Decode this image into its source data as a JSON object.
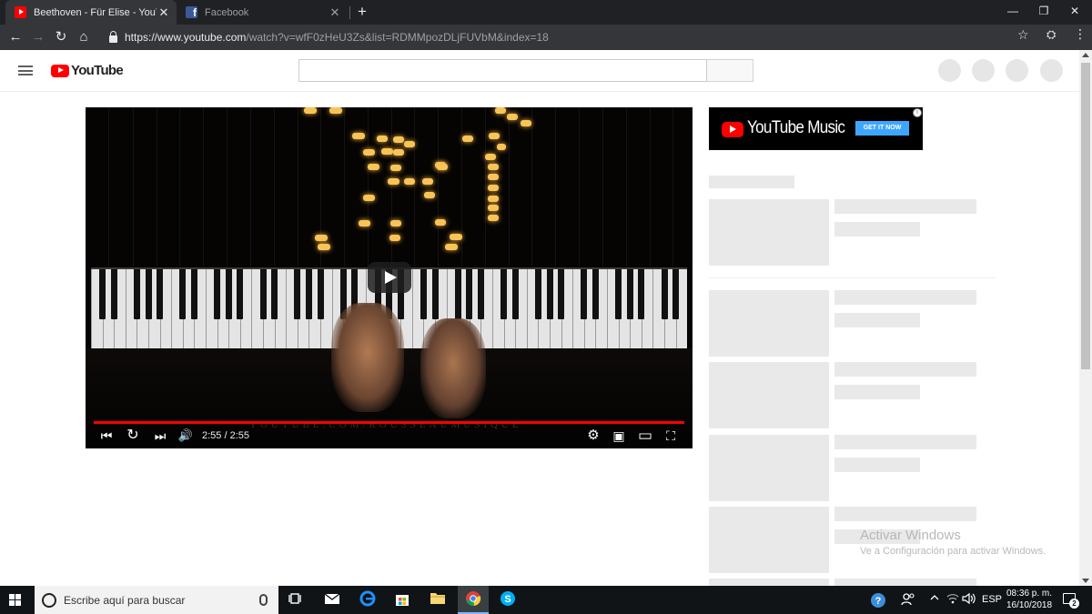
{
  "browser": {
    "tabs": [
      {
        "title": "Beethoven - Für Elise - YouTube",
        "close": "✕",
        "favicon": "youtube-favicon"
      },
      {
        "title": "Facebook",
        "close": "✕",
        "favicon": "facebook-favicon"
      }
    ],
    "new_tab": "+",
    "window": {
      "minimize": "—",
      "restore": "❐",
      "close": "✕"
    },
    "nav": {
      "back": "←",
      "forward": "→",
      "reload": "↻",
      "home": "⌂"
    },
    "url_base": "https://www.youtube.com",
    "url_rest": "/watch?v=wfF0zHeU3Zs&list=RDMMpozDLjFUVbM&index=18",
    "bookmark": "☆",
    "extension": "⛭",
    "menu": "⋮"
  },
  "youtube": {
    "logo_text": "YouTube",
    "brand_color": "#ff0000"
  },
  "player": {
    "watermark": "YOUTUBE.COM/ROUSSEAUMUSIQUE",
    "time": "2:55 / 2:55",
    "progress": 1.0,
    "controls": {
      "previous": "⏮",
      "replay": "↻",
      "next": "⏭",
      "volume": "🔊",
      "settings": "⚙",
      "miniplayer": "▣",
      "theater": "▭",
      "fullscreen": "⛶"
    }
  },
  "ad": {
    "brand": "YouTube Music",
    "cta": "GET IT NOW",
    "info": "i"
  },
  "windows_activation": {
    "title": "Activar Windows",
    "subtitle": "Ve a Configuración para activar Windows."
  },
  "taskbar": {
    "search_placeholder": "Escribe aquí para buscar",
    "language": "ESP",
    "time": "08:36 p. m.",
    "date": "16/10/2018",
    "notification_count": "2",
    "icons": [
      "task-view-icon",
      "mail-icon",
      "edge-icon",
      "store-icon",
      "file-explorer-icon",
      "chrome-icon",
      "skype-icon"
    ]
  }
}
